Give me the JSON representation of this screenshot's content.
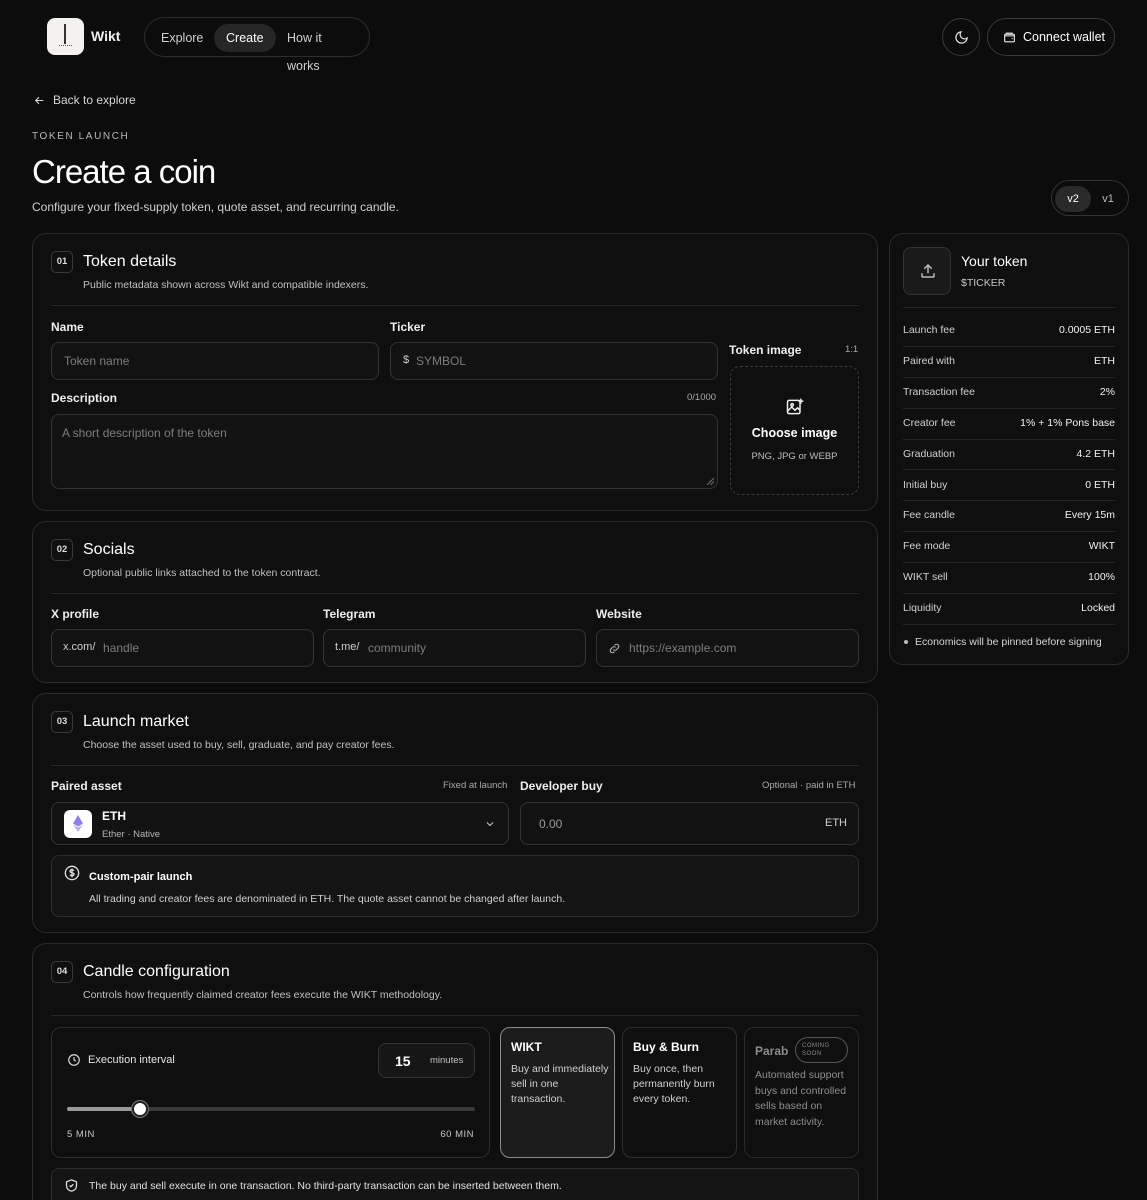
{
  "header": {
    "brand": "Wikt",
    "nav": [
      {
        "label": "Explore",
        "active": false
      },
      {
        "label": "Create",
        "active": true
      },
      {
        "label": "How it works",
        "active": false
      }
    ],
    "theme_icon": "moon-icon",
    "wallet_label": "Connect wallet"
  },
  "page": {
    "back_label": "Back to explore",
    "eyebrow": "TOKEN LAUNCH",
    "title": "Create a coin",
    "subtitle": "Configure your fixed-supply token, quote asset, and recurring candle.",
    "versions": [
      "v2",
      "v1"
    ],
    "active_version": "v2"
  },
  "token_details": {
    "number": "01",
    "title": "Token details",
    "desc": "Public metadata shown across Wikt and compatible indexers.",
    "name_label": "Name",
    "name_placeholder": "Token name",
    "ticker_label": "Ticker",
    "ticker_prefix": "$",
    "ticker_placeholder": "SYMBOL",
    "description_label": "Description",
    "description_count": "0/1000",
    "description_placeholder": "A short description of the token",
    "image_label": "Token image",
    "image_ratio": "1:1",
    "image_cta": "Choose image",
    "image_formats": "PNG, JPG or WEBP"
  },
  "socials": {
    "number": "02",
    "title": "Socials",
    "desc": "Optional public links attached to the token contract.",
    "x_label": "X profile",
    "x_prefix": "x.com/",
    "x_placeholder": "handle",
    "telegram_label": "Telegram",
    "telegram_prefix": "t.me/",
    "telegram_placeholder": "community",
    "website_label": "Website",
    "website_placeholder": "https://example.com"
  },
  "launch_market": {
    "number": "03",
    "title": "Launch market",
    "desc": "Choose the asset used to buy, sell, graduate, and pay creator fees.",
    "paired_label": "Paired asset",
    "paired_hint": "Fixed at launch",
    "asset_symbol": "ETH",
    "asset_sub": "Ether · Native",
    "dev_label": "Developer buy",
    "dev_hint": "Optional · paid in ETH",
    "dev_placeholder": "0.00",
    "dev_unit": "ETH",
    "notice_title": "Custom-pair launch",
    "notice_text": "All trading and creator fees are denominated in ETH. The quote asset cannot be changed after launch."
  },
  "candle": {
    "number": "04",
    "title": "Candle configuration",
    "desc": "Controls how frequently claimed creator fees execute the WIKT methodology.",
    "interval_label": "Execution interval",
    "interval_value": "15",
    "interval_unit": "minutes",
    "slider_min": "5 MIN",
    "slider_max": "60 MIN",
    "slider_fraction": 0.18,
    "modes": [
      {
        "title": "WIKT",
        "desc": "Buy and immediately sell in one transaction.",
        "selected": true
      },
      {
        "title": "Buy & Burn",
        "desc": "Buy once, then permanently burn every token.",
        "selected": false
      },
      {
        "title": "Parab",
        "badge": "COMING SOON",
        "desc": "Automated support buys and controlled sells based on market activity.",
        "selected": false
      }
    ],
    "footer_note": "The buy and sell execute in one transaction. No third-party transaction can be inserted between them."
  },
  "summary": {
    "title": "Your token",
    "ticker": "$TICKER",
    "rows": [
      {
        "label": "Launch fee",
        "value": "0.0005 ETH"
      },
      {
        "label": "Paired with",
        "value": "ETH"
      },
      {
        "label": "Transaction fee",
        "value": "2%"
      },
      {
        "label": "Creator fee",
        "value": "1% + 1% Pons base"
      },
      {
        "label": "Graduation",
        "value": "4.2 ETH"
      },
      {
        "label": "Initial buy",
        "value": "0 ETH"
      },
      {
        "label": "Fee candle",
        "value": "Every 15m"
      },
      {
        "label": "Fee mode",
        "value": "WIKT"
      },
      {
        "label": "WIKT sell",
        "value": "100%"
      },
      {
        "label": "Liquidity",
        "value": "Locked"
      }
    ],
    "note": "Economics will be pinned before signing"
  }
}
